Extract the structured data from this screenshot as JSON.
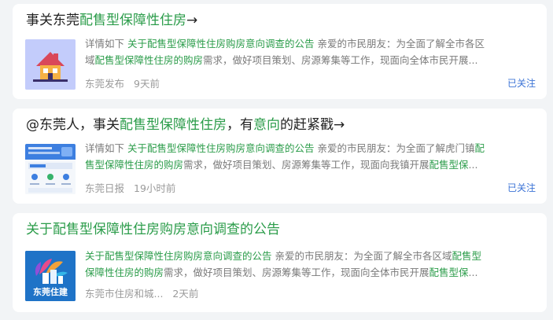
{
  "results": [
    {
      "title": {
        "pre": "事关东莞",
        "highlight": "配售型保障性住房",
        "post": "→"
      },
      "snippet_line1": {
        "a": "详情如下 ",
        "hl1": "关于配售型保障性住房购房意向调查的公告",
        "b": " 亲爱的市民朋友：为全面了解全市各区"
      },
      "snippet_line2": {
        "a": "域",
        "hl1": "配售型保障性住房的购房",
        "b": "需求，做好项目策划、房源筹集等工作，现面向全体市民开展..."
      },
      "source": "东莞发布",
      "time": "9天前",
      "follow": "已关注",
      "thumb_icon": "house-icon"
    },
    {
      "title": {
        "pre": "@东莞人，事关",
        "highlight": "配售型保障性住房",
        "mid": "，有",
        "highlight2": "意向",
        "post": "的赶紧戳→"
      },
      "snippet_line1": {
        "a": "详情如下 ",
        "hl1": "关于配售型保障性住房购房意向调查的公告",
        "b": " 亲爱的市民朋友：为全面了解虎门镇",
        "hl2": "配"
      },
      "snippet_line2": {
        "hl1": "售型保障性住房的购房",
        "b": "需求，做好项目策划、房源筹集等工作，现面向我镇开展",
        "hl2": "配售型保",
        "c": "..."
      },
      "source": "东莞日报",
      "time": "19小时前",
      "follow": "已关注",
      "thumb_icon": "app-screenshot-icon"
    },
    {
      "title": {
        "highlight": "关于配售型保障性住房购房意向调查的公告"
      },
      "snippet_line1": {
        "hl1": "关于配售型保障性住房购房意向调查的公告",
        "b": " 亲爱的市民朋友：为全面了解全市各区域",
        "hl2": "配售型"
      },
      "snippet_line2": {
        "hl1": "保障性住房的购房",
        "b": "需求，做好项目策划、房源筹集等工作，现面向全体市民开展",
        "hl2": "配售型保",
        "c": "..."
      },
      "source": "东莞市住房和城...",
      "time": "2天前",
      "thumb_icon": "dongguan-housing-logo",
      "thumb_logo_text": "东莞住建"
    }
  ],
  "colors": {
    "highlight": "#2b9c4a",
    "follow": "#3b73d6",
    "text": "#222222",
    "muted": "#9a9a9a"
  }
}
